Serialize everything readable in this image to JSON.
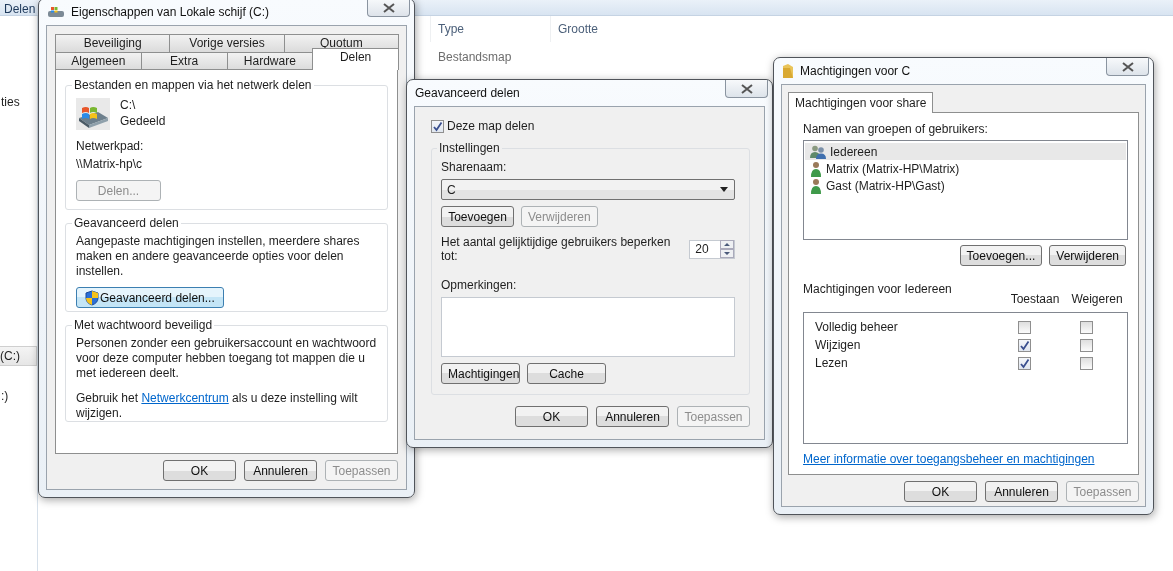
{
  "explorer": {
    "toolbar_label": "Delen",
    "nav_items": [
      {
        "label": "ties",
        "selected": false
      },
      {
        "label": "(C:)",
        "selected": true
      },
      {
        "label": ":)",
        "selected": false
      }
    ],
    "columns": [
      "Type",
      "Grootte"
    ],
    "rows": [
      {
        "type": "Bestandsmap"
      }
    ]
  },
  "properties_dialog": {
    "title": "Eigenschappen van Lokale schijf (C:)",
    "tab_rows": [
      [
        {
          "label": "Beveiliging",
          "selected": false
        },
        {
          "label": "Vorige versies",
          "selected": false
        },
        {
          "label": "Quotum",
          "selected": false
        }
      ],
      [
        {
          "label": "Algemeen",
          "selected": false
        },
        {
          "label": "Extra",
          "selected": false
        },
        {
          "label": "Hardware",
          "selected": false
        },
        {
          "label": "Delen",
          "selected": true
        }
      ]
    ],
    "network_sharing": {
      "heading": "Bestanden en mappen via het netwerk delen",
      "path": "C:\\",
      "status": "Gedeeld",
      "network_path_label": "Netwerkpad:",
      "network_path": "\\\\Matrix-hp\\c",
      "button": {
        "label": "Delen...",
        "disabled": true
      }
    },
    "advanced_sharing": {
      "heading": "Geavanceerd delen",
      "description": "Aangepaste machtigingen instellen, meerdere shares maken en andere geavanceerde opties voor delen instellen.",
      "button": {
        "label": "Geavanceerd delen...",
        "disabled": false
      }
    },
    "password_protection": {
      "heading": "Met wachtwoord beveiligd",
      "description": "Personen zonder een gebruikersaccount en wachtwoord voor deze computer hebben toegang tot mappen die u met iedereen deelt.",
      "footer_before": "Gebruik het ",
      "footer_link": "Netwerkcentrum",
      "footer_after": " als u deze instelling wilt wijzigen."
    },
    "buttons": [
      {
        "label": "OK",
        "disabled": false
      },
      {
        "label": "Annuleren",
        "disabled": false
      },
      {
        "label": "Toepassen",
        "disabled": true
      }
    ]
  },
  "advanced_sharing_dialog": {
    "title": "Geavanceerd delen",
    "share_checkbox": {
      "label": "Deze map delen",
      "checked": true
    },
    "settings_heading": "Instellingen",
    "share_name_label": "Sharenaam:",
    "share_name": "C",
    "share_buttons": [
      {
        "label": "Toevoegen",
        "disabled": false
      },
      {
        "label": "Verwijderen",
        "disabled": true
      }
    ],
    "user_limit_label": "Het aantal gelijktijdige gebruikers beperken tot:",
    "user_limit": "20",
    "comments_label": "Opmerkingen:",
    "extra_buttons": [
      {
        "label": "Machtigingen",
        "disabled": false
      },
      {
        "label": "Cache",
        "disabled": false
      }
    ],
    "buttons": [
      {
        "label": "OK",
        "disabled": false
      },
      {
        "label": "Annuleren",
        "disabled": false
      },
      {
        "label": "Toepassen",
        "disabled": true
      }
    ]
  },
  "permissions_dialog": {
    "title": "Machtigingen voor C",
    "tab": {
      "label": "Machtigingen voor share",
      "selected": true
    },
    "users_label": "Namen van groepen of gebruikers:",
    "users": [
      {
        "name": "Iedereen",
        "kind": "group",
        "selected": true
      },
      {
        "name": "Matrix (Matrix-HP\\Matrix)",
        "kind": "user",
        "selected": false
      },
      {
        "name": "Gast (Matrix-HP\\Gast)",
        "kind": "user",
        "selected": false
      }
    ],
    "user_buttons": [
      {
        "label": "Toevoegen...",
        "disabled": false
      },
      {
        "label": "Verwijderen",
        "disabled": false
      }
    ],
    "permissions_label": "Machtigingen voor Iedereen",
    "columns": [
      "Toestaan",
      "Weigeren"
    ],
    "permissions": [
      {
        "name": "Volledig beheer",
        "allow": false,
        "deny": false
      },
      {
        "name": "Wijzigen",
        "allow": true,
        "deny": false
      },
      {
        "name": "Lezen",
        "allow": true,
        "deny": false
      }
    ],
    "info_link": "Meer informatie over toegangsbeheer en machtigingen",
    "buttons": [
      {
        "label": "OK",
        "disabled": false
      },
      {
        "label": "Annuleren",
        "disabled": false
      },
      {
        "label": "Toepassen",
        "disabled": true
      }
    ]
  }
}
